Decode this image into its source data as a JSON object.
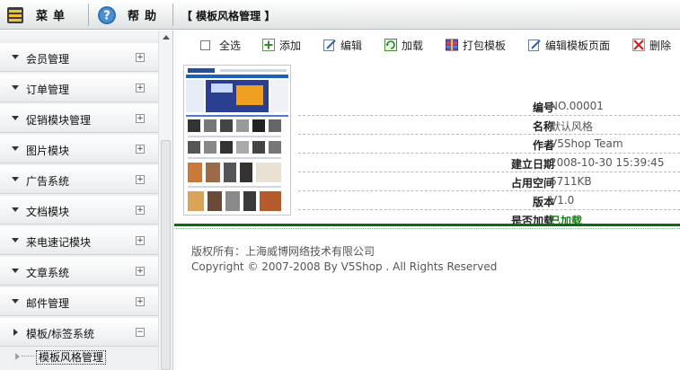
{
  "topbar": {
    "menu_label": "菜单",
    "help_label": "帮助",
    "page_title": "【 模板风格管理 】"
  },
  "sidebar": {
    "items": [
      {
        "label": "会员管理",
        "expanded": false
      },
      {
        "label": "订单管理",
        "expanded": false
      },
      {
        "label": "促销模块管理",
        "expanded": false
      },
      {
        "label": "图片模块",
        "expanded": false
      },
      {
        "label": "广告系统",
        "expanded": false
      },
      {
        "label": "文档模块",
        "expanded": false
      },
      {
        "label": "来电速记模块",
        "expanded": false
      },
      {
        "label": "文章系统",
        "expanded": false
      },
      {
        "label": "邮件管理",
        "expanded": false
      },
      {
        "label": "模板/标签系统",
        "expanded": true
      }
    ],
    "sub_item": "模板风格管理",
    "plus_symbol": "+",
    "minus_symbol": "−"
  },
  "toolbar": {
    "select_all": "全选",
    "add": "添加",
    "edit": "编辑",
    "load": "加载",
    "pack": "打包模板",
    "edit_page": "编辑模板页面",
    "delete": "删除"
  },
  "template": {
    "fields": [
      {
        "key": "编号",
        "value": "NO.00001"
      },
      {
        "key": "名称",
        "value": "默认风格"
      },
      {
        "key": "作者",
        "value": "V5Shop Team"
      },
      {
        "key": "建立日期",
        "value": "2008-10-30 15:39:45"
      },
      {
        "key": "占用空间",
        "value": "6711KB"
      },
      {
        "key": "版本",
        "value": "V1.0"
      },
      {
        "key": "是否加载",
        "value": "已加载"
      }
    ]
  },
  "footer": {
    "line1": "版权所有：上海威博网络技术有限公司",
    "line2": "Copyright © 2007-2008 By V5Shop . All Rights Reserved"
  },
  "colors": {
    "accent_green": "#0c6b16",
    "loaded_green": "#1b7c1b"
  }
}
